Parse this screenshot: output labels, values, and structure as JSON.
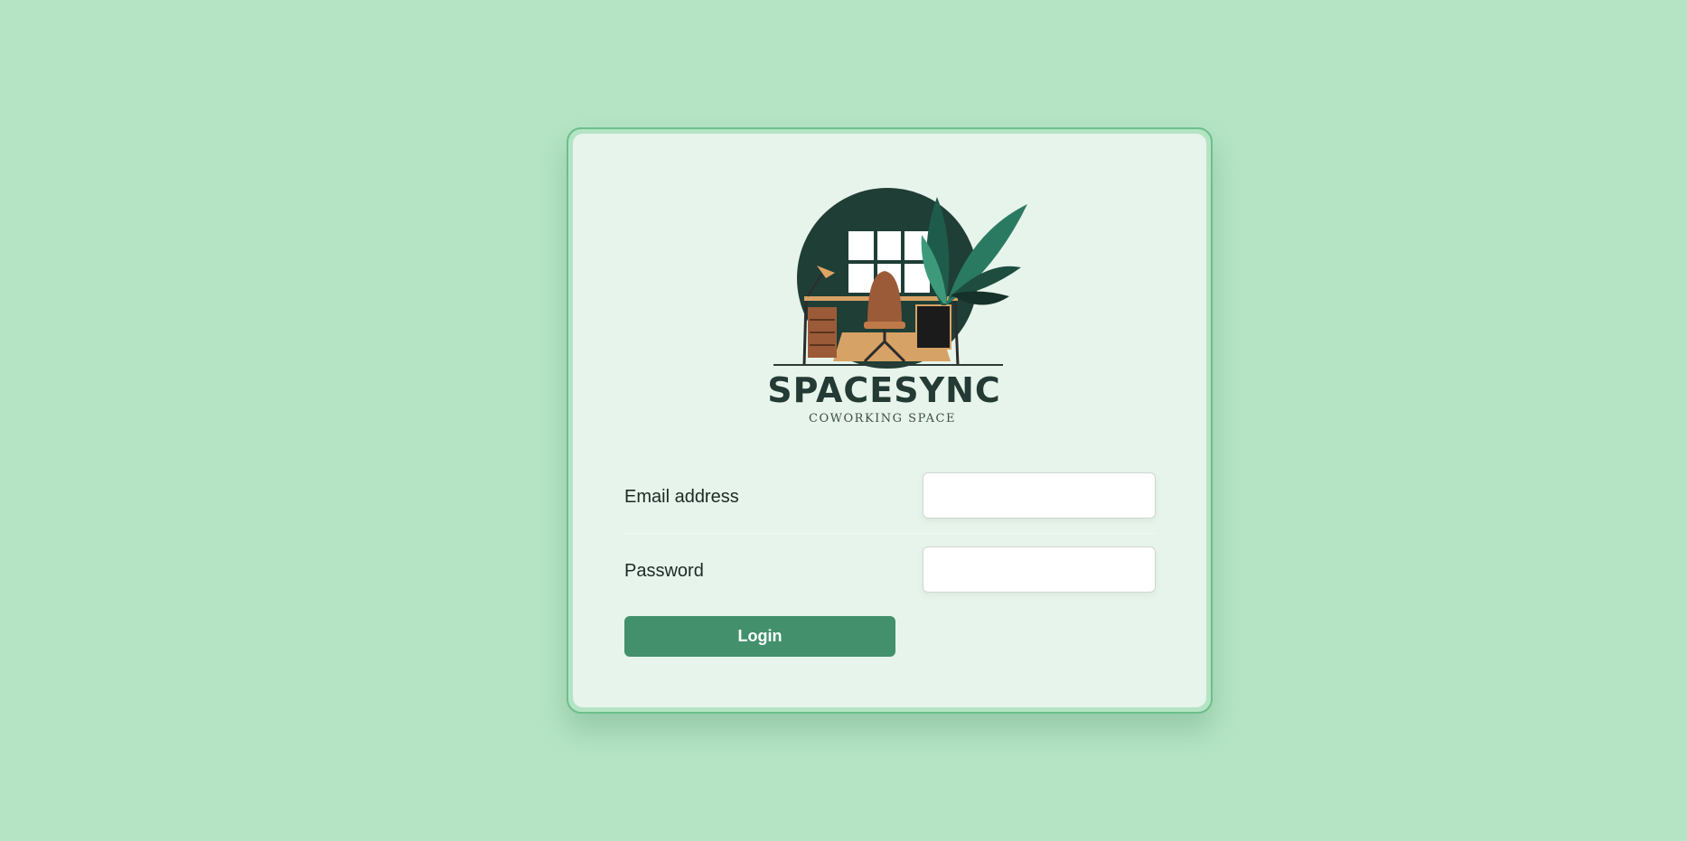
{
  "brand": {
    "name": "SPACESYNC",
    "tagline": "COWORKING SPACE"
  },
  "form": {
    "email_label": "Email address",
    "email_value": "",
    "password_label": "Password",
    "password_value": "",
    "login_label": "Login"
  },
  "colors": {
    "background": "#b4e4c4",
    "card": "#e7f4eb",
    "accent": "#42916c",
    "logo_dark": "#243a34"
  },
  "icons": {
    "logo": "coworking-desk-illustration"
  }
}
